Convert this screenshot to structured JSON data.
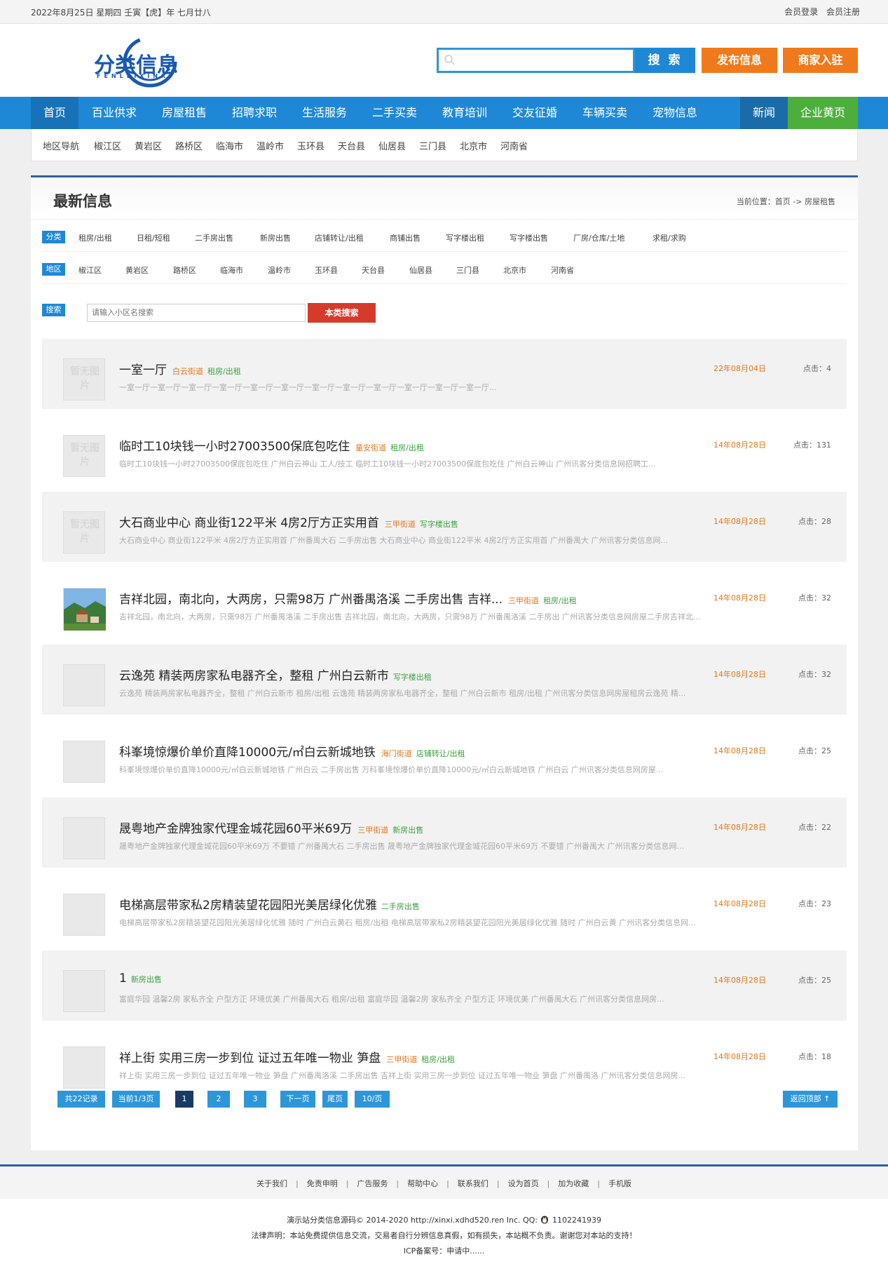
{
  "topbar": {
    "date": "2022年8月25日 星期四 壬寅【虎】年 七月廿八",
    "login": "会员登录",
    "register": "会员注册"
  },
  "header": {
    "logo_main": "分类信息",
    "logo_sub": "FENLEIXINXI",
    "search_placeholder": "",
    "search_button": "搜 索",
    "post_button": "发布信息",
    "merchant_button": "商家入驻"
  },
  "nav": {
    "items": [
      "首页",
      "百业供求",
      "房屋租售",
      "招聘求职",
      "生活服务",
      "二手买卖",
      "教育培训",
      "交友征婚",
      "车辆买卖",
      "宠物信息"
    ],
    "news": "新闻",
    "biz": "企业黄页"
  },
  "areabar": {
    "items": [
      "地区导航",
      "椒江区",
      "黄岩区",
      "路桥区",
      "临海市",
      "温岭市",
      "玉环县",
      "天台县",
      "仙居县",
      "三门县",
      "北京市",
      "河南省"
    ]
  },
  "main": {
    "title": "最新信息",
    "breadcrumb": "当前位置：首页 -> 房屋租售"
  },
  "filters": {
    "category_tag": "分类",
    "categories": [
      "租房/出租",
      "日租/短租",
      "二手房出售",
      "新房出售",
      "店铺转让/出租",
      "商铺出售",
      "写字楼出租",
      "写字楼出售",
      "厂房/仓库/土地",
      "求租/求购"
    ],
    "area_tag": "地区",
    "areas": [
      "椒江区",
      "黄岩区",
      "路桥区",
      "临海市",
      "温岭市",
      "玉环县",
      "天台县",
      "仙居县",
      "三门县",
      "北京市",
      "河南省"
    ],
    "search_tag": "搜索",
    "search_placeholder": "请输入小区名搜索",
    "search_button": "本类搜索"
  },
  "listings": [
    {
      "title": "一室一厅",
      "tag1": "白云街道",
      "tag2": "租房/出租",
      "desc": "一室一厅一室一厅一室一厅一室一厅一室一厅一室一厅一室一厅一室一厅一室一厅一室一厅一室一厅一室一厅...",
      "date": "22年08月04日",
      "hits": "点击：4",
      "thumb": "noimg"
    },
    {
      "title": "临时工10块钱一小时27003500保底包吃住",
      "tag1": "童安街道",
      "tag2": "租房/出租",
      "desc": "临时工10块钱一小时27003500保底包吃住 广州白云神山 工人/技工 临时工10块钱一小时27003500保底包吃住 广州白云神山 广州讯客分类信息网招聘工...",
      "date": "14年08月28日",
      "hits": "点击：131",
      "thumb": "noimg"
    },
    {
      "title": "大石商业中心 商业街122平米 4房2厅方正实用首",
      "tag1": "三甲街道",
      "tag2": "写字楼出售",
      "desc": "大石商业中心 商业街122平米 4房2厅方正实用首 广州番禺大石 二手房出售 大石商业中心 商业街122平米 4房2厅方正实用首 广州番禺大 广州讯客分类信息网...",
      "date": "14年08月28日",
      "hits": "点击：28",
      "thumb": "noimg"
    },
    {
      "title": "吉祥北园，南北向，大两房，只需98万 广州番禺洛溪 二手房出售 吉祥...",
      "tag1": "三甲街道",
      "tag2": "租房/出租",
      "desc": "吉祥北园，南北向，大两房，只需98万 广州番禺洛溪 二手房出售 吉祥北园，南北向，大两房，只需98万 广州番禺洛溪 二手房出 广州讯客分类信息网房屋二手房吉祥北...",
      "date": "14年08月28日",
      "hits": "点击：32",
      "thumb": "photo"
    },
    {
      "title": "云逸苑 精装两房家私电器齐全，整租 广州白云新市",
      "tag1": "",
      "tag2": "写字楼出租",
      "desc": "云逸苑 精装两房家私电器齐全，整租 广州白云新市 租房/出租 云逸苑 精装两房家私电器齐全，整租 广州白云新市 租房/出租 广州讯客分类信息网房屋租房云逸苑 精...",
      "date": "14年08月28日",
      "hits": "点击：32",
      "thumb": "blank"
    },
    {
      "title": "科峯境惊爆价单价直降10000元/㎡白云新城地铁",
      "tag1": "海门街道",
      "tag2": "店铺转让/出租",
      "desc": "科峯境惊爆价单价直降10000元/㎡白云新城地铁 广州白云 二手房出售 万科峯境惊爆价单价直降10000元/㎡白云新城地铁 广州白云 广州讯客分类信息网房屋...",
      "date": "14年08月28日",
      "hits": "点击：25",
      "thumb": "blank"
    },
    {
      "title": "晟粤地产金牌独家代理金城花园60平米69万",
      "tag1": "三甲街道",
      "tag2": "新房出售",
      "desc": "晟粤地产金牌独家代理金城花园60平米69万 不要错 广州番禺大石 二手房出售 晟粤地产金牌独家代理金城花园60平米69万 不要错 广州番禺大 广州讯客分类信息网...",
      "date": "14年08月28日",
      "hits": "点击：22",
      "thumb": "blank"
    },
    {
      "title": "电梯高层带家私2房精装望花园阳光美居绿化优雅",
      "tag1": "",
      "tag2": "二手房出售",
      "desc": "电梯高层带家私2房精装望花园阳光美居绿化优雅 随时 广州白云黄石 租房/出租 电梯高层带家私2房精装望花园阳光美居绿化优雅 随时 广州白云黄 广州讯客分类信息网...",
      "date": "14年08月28日",
      "hits": "点击：23",
      "thumb": "blank"
    },
    {
      "title": "1",
      "tag1": "",
      "tag2": "新房出售",
      "desc": "富庭华园 温馨2房 家私齐全 户型方正 环境优美 广州番禺大石 租房/出租 富庭华园 温馨2房 家私齐全 户型方正 环境优美 广州番禺大石 广州讯客分类信息网房...",
      "date": "14年08月28日",
      "hits": "点击：25",
      "thumb": "blank"
    },
    {
      "title": "祥上街 实用三房一步到位 证过五年唯一物业 笋盘",
      "tag1": "三甲街道",
      "tag2": "租房/出租",
      "desc": "祥上街 实用三房一步到位 证过五年唯一物业 笋盘 广州番禺洛溪 二手房出售 吉祥上街 实用三房一步到位 证过五年唯一物业 笋盘 广州番禺洛 广州讯客分类信息网房...",
      "date": "14年08月28日",
      "hits": "点击：18",
      "thumb": "blank"
    }
  ],
  "noimg_text": "暂无图片",
  "pager": {
    "total": "共22记录",
    "current": "当前1/3页",
    "pages": [
      "1",
      "2",
      "3"
    ],
    "next": "下一页",
    "last": "尾页",
    "per_page": "10/页",
    "back_top": "返回顶部 ↑"
  },
  "footer": {
    "links": [
      "关于我们",
      "免责申明",
      "广告服务",
      "帮助中心",
      "联系我们",
      "设为首页",
      "加为收藏",
      "手机版"
    ],
    "copyright_pre": "演示站分类信息源码© 2014-2020 http://xinxi.xdhd520.ren Inc. QQ:",
    "qq": "1102241939",
    "disclaimer": "法律声明：本站免费提供信息交流，交易者自行分辨信息真假，如有损失，本站概不负责。谢谢您对本站的支持！",
    "icp": "ICP备案号：申请中......"
  },
  "colors": {
    "primary": "#1e88d6",
    "orange": "#f07a1b",
    "green": "#4caf3c",
    "red": "#d53b2b",
    "navy": "#2d5fa8"
  }
}
